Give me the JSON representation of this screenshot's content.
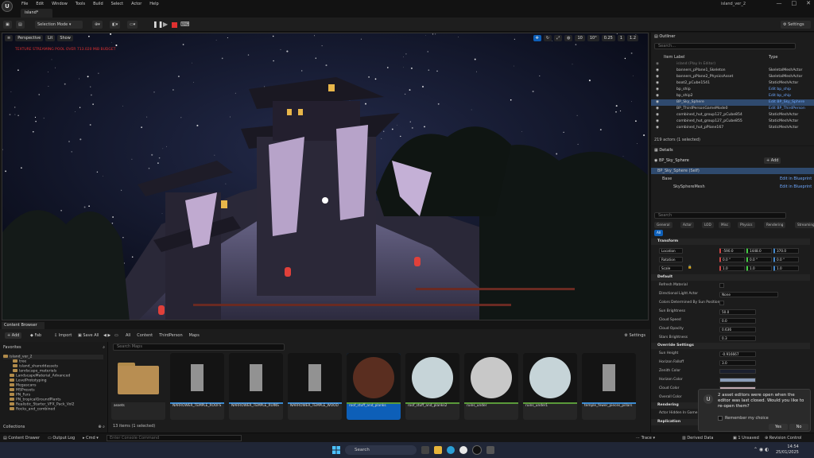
{
  "menubar": {
    "items": [
      "File",
      "Edit",
      "Window",
      "Tools",
      "Build",
      "Select",
      "Actor",
      "Help"
    ],
    "project_name": "island_ver_2",
    "window_controls": [
      "—",
      "□",
      "✕"
    ]
  },
  "tab": {
    "label": "island*"
  },
  "toolbar": {
    "mode_label": "Selection Mode",
    "settings_label": "Settings"
  },
  "viewport": {
    "perspective_label": "Perspective",
    "lit_label": "Lit",
    "show_label": "Show",
    "warning": "TEXTURE STREAMING POOL OVER 713.020 MiB BUDGET",
    "grid_snap": "10",
    "rot_snap": "10°",
    "scale_snap": "0.25",
    "camera_speed": "1",
    "viewports": "1.2"
  },
  "content_browser": {
    "tab_label": "Content Browser",
    "add_label": "Add",
    "fab_label": "Fab",
    "import_label": "Import",
    "save_all_label": "Save All",
    "breadcrumb": [
      "All",
      "Content",
      "ThirdPerson",
      "Maps"
    ],
    "settings_label": "Settings",
    "favorites_label": "Favorites",
    "collections_label": "Collections",
    "search_placeholder": "Search Maps",
    "items_status": "13 items (1 selected)",
    "tree": [
      {
        "label": "island_ver_2",
        "depth": 0,
        "folder": false
      },
      {
        "label": "tree",
        "depth": 3,
        "folder": true
      },
      {
        "label": "island_shareddassets",
        "depth": 3,
        "folder": true
      },
      {
        "label": "landscape_materials",
        "depth": 3,
        "folder": true
      },
      {
        "label": "LandscapeMaterial_Advanced",
        "depth": 2,
        "folder": true
      },
      {
        "label": "LevelPrototyping",
        "depth": 2,
        "folder": true
      },
      {
        "label": "Megascans",
        "depth": 2,
        "folder": true
      },
      {
        "label": "MSPresets",
        "depth": 2,
        "folder": true
      },
      {
        "label": "PN_Furs",
        "depth": 2,
        "folder": true
      },
      {
        "label": "PN_tropicalGroundPlants",
        "depth": 2,
        "folder": true
      },
      {
        "label": "Realistic_Starter_VFX_Pack_Vol2",
        "depth": 2,
        "folder": true
      },
      {
        "label": "Rocks_and_combined",
        "depth": 2,
        "folder": true
      }
    ],
    "assets": [
      {
        "name": "assets",
        "kind": "folder"
      },
      {
        "name": "NARROWER_TEMPLE_ROOFS",
        "kind": "mesh"
      },
      {
        "name": "NARROWER_TEMPLE_RUINS",
        "kind": "mesh"
      },
      {
        "name": "NARROWER_TEMPLE_WOOD",
        "kind": "mesh"
      },
      {
        "name": "roof_stuff_and_planks",
        "kind": "material",
        "selected": true
      },
      {
        "name": "roof_stuff_and_planks2",
        "kind": "material"
      },
      {
        "name": "ruins_under",
        "kind": "material"
      },
      {
        "name": "ruins_under1",
        "kind": "material"
      },
      {
        "name": "temple_fewer_pieces_pillars",
        "kind": "mesh"
      }
    ]
  },
  "outliner": {
    "title": "Outliner",
    "search_placeholder": "Search...",
    "col_label": "Item Label",
    "col_type": "Type",
    "rows": [
      {
        "label": "island (Play In Editor)",
        "type": "",
        "dim": true
      },
      {
        "label": "banners_pPlane1_Skeleton",
        "type": "SkeletalMeshActor"
      },
      {
        "label": "banners_pPlane2_PhysicsAsset",
        "type": "SkeletalMeshActor"
      },
      {
        "label": "boat2_pCube1541",
        "type": "StaticMeshActor"
      },
      {
        "label": "bp_ship",
        "type": "Edit bp_ship",
        "link": true
      },
      {
        "label": "bp_ship2",
        "type": "Edit bp_ship",
        "link": true
      },
      {
        "label": "BP_Sky_Sphere",
        "type": "Edit BP_Sky_Sphere",
        "link": true,
        "selected": true
      },
      {
        "label": "BP_ThirdPersonGameMode0",
        "type": "Edit BP_ThirdPerson",
        "link": true
      },
      {
        "label": "combined_hut_group127_pCube854",
        "type": "StaticMeshActor"
      },
      {
        "label": "combined_hut_group127_pCube855",
        "type": "StaticMeshActor"
      },
      {
        "label": "combined_hut_pPlane167",
        "type": "StaticMeshActor"
      }
    ],
    "status": "219 actors (1 selected)"
  },
  "details": {
    "title": "Details",
    "actor_name": "BP_Sky_Sphere",
    "add_label": "Add",
    "self_label": "BP_Sky_Sphere (Self)",
    "components": [
      {
        "label": "Base",
        "link": "Edit in Blueprint"
      },
      {
        "label": "SkySphereMesh",
        "link": "Edit in Blueprint"
      }
    ],
    "search_placeholder": "Search",
    "category_tabs": [
      "General",
      "Actor",
      "LOD",
      "Misc",
      "Physics",
      "Rendering",
      "Streaming",
      "All"
    ],
    "transform_label": "Transform",
    "location_label": "Location",
    "rotation_label": "Rotation",
    "scale_label": "Scale",
    "location": [
      "-590.0",
      "1448.0",
      "370.0"
    ],
    "rotation": [
      "0.0 °",
      "0.0 °",
      "0.0 °"
    ],
    "scale": [
      "1.0",
      "1.0",
      "1.0"
    ],
    "default_label": "Default",
    "props": [
      {
        "label": "Refresh Material",
        "kind": "check"
      },
      {
        "label": "Directional Light Actor",
        "kind": "select",
        "value": "None"
      },
      {
        "label": "Colors Determined By Sun Position",
        "kind": "check"
      },
      {
        "label": "Sun Brightness",
        "kind": "num",
        "value": "50.0"
      },
      {
        "label": "Cloud Speed",
        "kind": "num",
        "value": "0.0"
      },
      {
        "label": "Cloud Opacity",
        "kind": "num",
        "value": "0.636"
      },
      {
        "label": "Stars Brightness",
        "kind": "num",
        "value": "0.3"
      }
    ],
    "override_label": "Override Settings",
    "override_props": [
      {
        "label": "Sun Height",
        "kind": "num",
        "value": "-0.916667"
      },
      {
        "label": "Horizon Falloff",
        "kind": "num",
        "value": "3.0"
      },
      {
        "label": "Zenith Color",
        "kind": "color",
        "value": "#1a1f2e"
      },
      {
        "label": "Horizon Color",
        "kind": "color",
        "value": "#8a9cb8"
      },
      {
        "label": "Cloud Color",
        "kind": "color",
        "value": "#c0a8b0"
      },
      {
        "label": "Overall Color",
        "kind": "color",
        "value": "#e8e8e8"
      }
    ],
    "rendering_label": "Rendering",
    "actor_hidden_label": "Actor Hidden In Game",
    "replication_label": "Replication"
  },
  "notification": {
    "message": "2 asset editors were open when the editor was last closed. Would you like to re-open them?",
    "remember_label": "Remember my choice",
    "yes_label": "Yes",
    "no_label": "No"
  },
  "statusbar": {
    "content_drawer": "Content Drawer",
    "output_log": "Output Log",
    "cmd": "Cmd",
    "console_placeholder": "Enter Console Command",
    "trace": "Trace",
    "derived_data": "Derived Data",
    "unsaved": "1 Unsaved",
    "revision": "Revision Control"
  },
  "taskbar": {
    "search_placeholder": "Search",
    "time": "14:54",
    "date": "25/01/2025"
  }
}
